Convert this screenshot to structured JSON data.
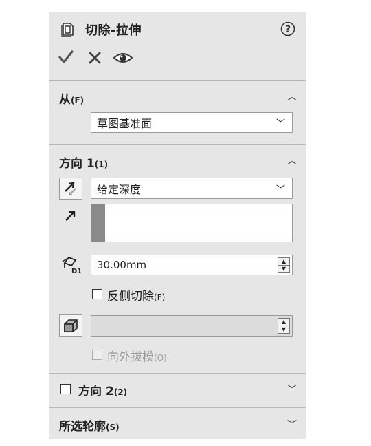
{
  "header": {
    "title": "切除-拉伸",
    "help_icon": "help-icon",
    "actions": {
      "ok_icon": "checkmark-icon",
      "cancel_icon": "close-icon",
      "preview_icon": "eye-icon"
    }
  },
  "from_section": {
    "label": "从",
    "shortcut": "(F)",
    "selected": "草图基准面"
  },
  "direction1": {
    "label": "方向 1",
    "shortcut": "(1)",
    "end_condition": "给定深度",
    "depth_value": "30.00mm",
    "flip_side_label": "反侧切除",
    "flip_side_shortcut": "(F)",
    "flip_side_checked": false,
    "draft_value": "",
    "draft_outward_label": "向外拔模",
    "draft_outward_shortcut": "(O)",
    "draft_outward_enabled": false
  },
  "direction2": {
    "label": "方向 2",
    "shortcut": "(2)",
    "checked": false
  },
  "selected_contours": {
    "label": "所选轮廓",
    "shortcut": "(S)"
  },
  "colors": {
    "panel_bg": "#e6e6e6",
    "separator": "#b9b9b9",
    "accent_bar": "#8a8a8a"
  }
}
